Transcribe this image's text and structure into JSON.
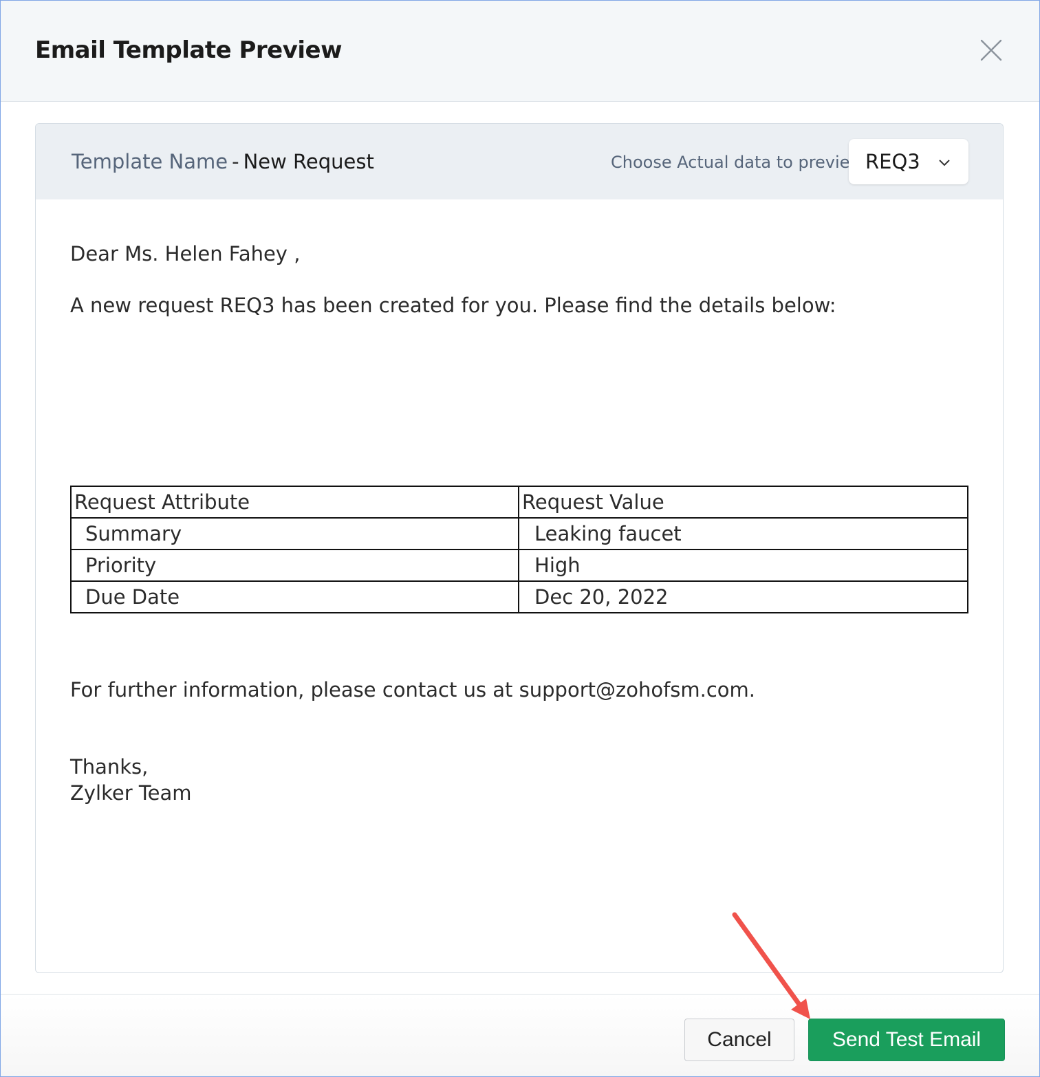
{
  "dialog": {
    "title": "Email Template Preview",
    "close_icon": "close-icon"
  },
  "preview_bar": {
    "template_label": "Template Name",
    "separator": "-",
    "template_name": "New Request",
    "choose_label": "Choose Actual data to preview",
    "selected_record": "REQ3",
    "chevron_icon": "chevron-down-icon"
  },
  "email": {
    "greeting": "Dear Ms. Helen Fahey ,",
    "intro": "A new request REQ3  has been created for you. Please find the details below:",
    "table": {
      "headers": [
        "Request Attribute",
        "Request Value"
      ],
      "rows": [
        [
          "Summary",
          "Leaking faucet"
        ],
        [
          "Priority",
          "High"
        ],
        [
          "Due Date",
          "Dec 20, 2022"
        ]
      ]
    },
    "contact_line": "For further information, please contact us at support@zohofsm.com.",
    "signoff": "Thanks,",
    "signature": "Zylker Team"
  },
  "footer": {
    "cancel_label": "Cancel",
    "send_label": "Send Test Email"
  },
  "colors": {
    "primary_button": "#1a9e5c",
    "header_bg": "#f4f7f9",
    "preview_bar_bg": "#ebeff3",
    "muted_text": "#56657a",
    "annotation_arrow": "#f0524b"
  }
}
